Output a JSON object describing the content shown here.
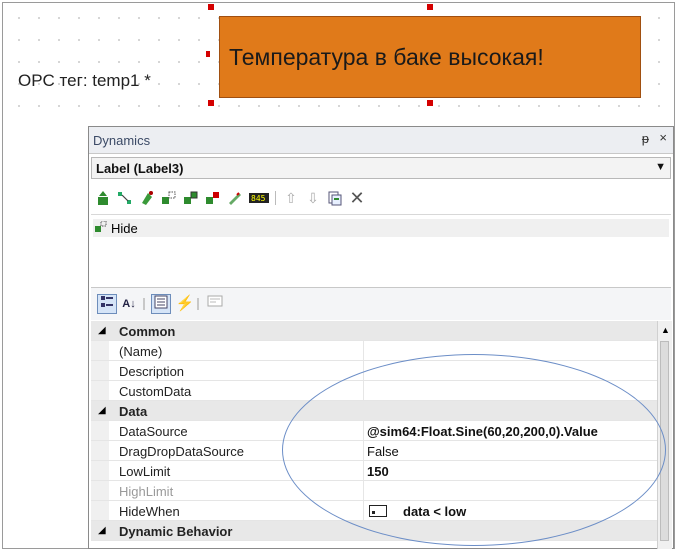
{
  "canvas": {
    "opc_label": "OPC тег: temp1 *",
    "alarm_text": "Температура в баке высокая!",
    "alarm_color": "#e07a1a"
  },
  "panel": {
    "title": "Dynamics",
    "pin_glyph": "ᵽ",
    "close_glyph": "×",
    "object_select": "Label (Label3)",
    "toolbar_icons": [
      "add-dynamic-icon",
      "connect-icon",
      "fill-icon",
      "hide-icon",
      "enable-icon",
      "blink-icon",
      "color-icon",
      "value-display-icon",
      "move-up-icon",
      "move-down-icon",
      "copy-icon",
      "delete-icon"
    ],
    "dynamics_list": [
      {
        "label": "Hide"
      }
    ],
    "grid_toolbar": [
      "categorized-icon",
      "alphabetical-icon",
      "properties-icon",
      "events-icon",
      "property-pages-icon"
    ]
  },
  "properties": {
    "common_label": "Common",
    "name_label": "(Name)",
    "description_label": "Description",
    "customdata_label": "CustomData",
    "data_label": "Data",
    "datasource_label": "DataSource",
    "datasource_value": "@sim64:Float.Sine(60,20,200,0).Value",
    "dragdrop_label": "DragDropDataSource",
    "dragdrop_value": "False",
    "lowlimit_label": "LowLimit",
    "lowlimit_value": "150",
    "highlimit_label": "HighLimit",
    "hidewhen_label": "HideWhen",
    "hidewhen_value": "data < low",
    "dynamic_label": "Dynamic Behavior"
  }
}
